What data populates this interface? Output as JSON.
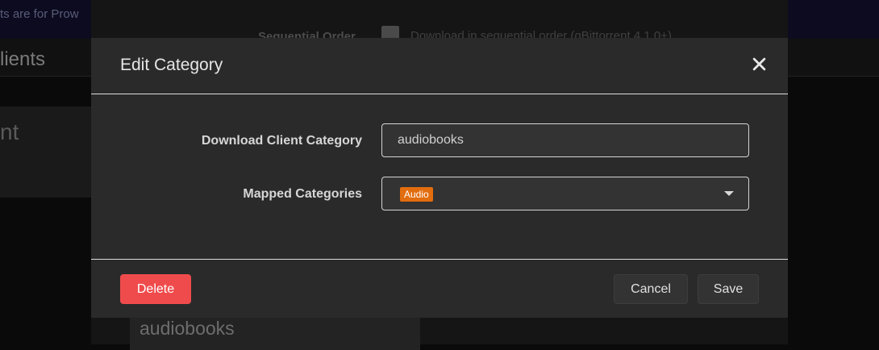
{
  "background": {
    "banner_text": "ts are for Prow",
    "page_title": "lients",
    "card_text": "nt",
    "sequential_label": "Sequential Order",
    "sequential_text": "Download in sequential order (qBittorrent 4.1.0+)",
    "bottom_card_text": "audiobooks"
  },
  "modal": {
    "title": "Edit Category",
    "close_icon": "close-icon",
    "fields": {
      "client_category": {
        "label": "Download Client Category",
        "value": "audiobooks"
      },
      "mapped_categories": {
        "label": "Mapped Categories",
        "tags": [
          "Audio"
        ],
        "tag_color": "#e26d0f"
      }
    },
    "footer": {
      "delete_label": "Delete",
      "cancel_label": "Cancel",
      "save_label": "Save"
    }
  },
  "colors": {
    "danger": "#f04b4c",
    "modal_bg": "#2a2a2a"
  }
}
